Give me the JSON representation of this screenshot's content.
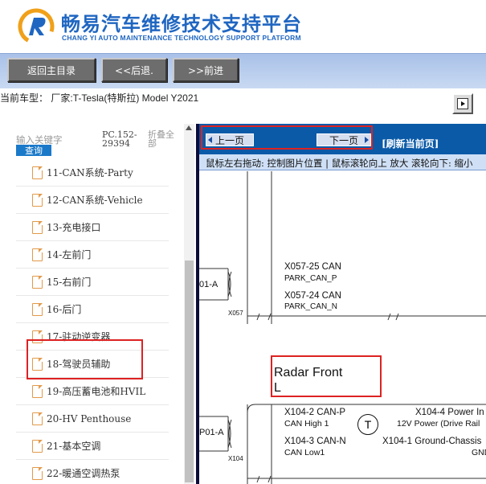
{
  "header": {
    "title_cn": "畅易汽车维修技术支持平台",
    "title_en": "CHANG YI AUTO MAINTENANCE TECHNOLOGY SUPPORT PLATFORM"
  },
  "toolbar": {
    "home_label": "返回主目录",
    "back_label": "<<后退.",
    "forward_label": ">>前进"
  },
  "carbar": {
    "text": "当前车型： 厂家:T-Tesla(特斯拉) Model Y2021"
  },
  "sidebar": {
    "search_placeholder": "输入关键字",
    "search_button": "查询",
    "pc_code": "PC.152-29394",
    "collapse_all": "折叠全部",
    "items": [
      {
        "label": "11-CAN系统-Party"
      },
      {
        "label": "12-CAN系统-Vehicle"
      },
      {
        "label": "13-充电接口"
      },
      {
        "label": "14-左前门"
      },
      {
        "label": "15-右前门"
      },
      {
        "label": "16-后门"
      },
      {
        "label": "17-驻动逆变器"
      },
      {
        "label": "18-驾驶员辅助"
      },
      {
        "label": "19-高压蓄电池和HVIL"
      },
      {
        "label": "20-HV Penthouse"
      },
      {
        "label": "21-基本空调"
      },
      {
        "label": "22-暖通空调热泵"
      }
    ]
  },
  "viewer": {
    "prev_label": "上一页",
    "next_label": "下一页",
    "refresh_label": "[刷新当前页]",
    "hint": "鼠标左右拖动: 控制图片位置 | 鼠标滚轮向上 放大  滚轮向下: 缩小"
  },
  "diagram": {
    "label_01a": "01-A",
    "label_x057": "X057",
    "x057_25": "X057-25 CAN",
    "x057_25_sub": "PARK_CAN_P",
    "x057_24": "X057-24 CAN",
    "x057_24_sub": "PARK_CAN_N",
    "radar_line1": "Radar Front",
    "radar_line2": "L",
    "label_p01a": "P01-A",
    "label_x104": "X104",
    "x104_2": "X104-2 CAN-P",
    "x104_2_sub": "CAN High 1",
    "x104_3": "X104-3 CAN-N",
    "x104_3_sub": "CAN Low1",
    "circle": "T",
    "x104_4": "X104-4 Power In",
    "x104_4_sub": "12V Power (Drive Rail",
    "x104_1": "X104-1 Ground-Chassis",
    "x104_1_sub": "GND"
  },
  "colors": {
    "brand_blue": "#1f66c1",
    "nav_blue": "#0a5aa8",
    "highlight_red": "#dd2222"
  }
}
